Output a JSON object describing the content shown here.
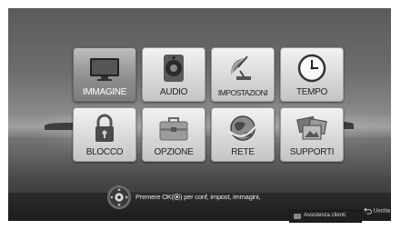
{
  "menu": {
    "items": [
      {
        "label": "IMMAGINE",
        "icon": "tv-icon",
        "selected": true
      },
      {
        "label": "AUDIO",
        "icon": "speaker-icon",
        "selected": false
      },
      {
        "label": "IMPOSTAZIONI",
        "icon": "satellite-dish-icon",
        "selected": false
      },
      {
        "label": "TEMPO",
        "icon": "clock-icon",
        "selected": false
      },
      {
        "label": "BLOCCO",
        "icon": "padlock-icon",
        "selected": false
      },
      {
        "label": "OPZIONE",
        "icon": "toolbox-icon",
        "selected": false
      },
      {
        "label": "RETE",
        "icon": "globe-network-icon",
        "selected": false
      },
      {
        "label": "SUPPORTI",
        "icon": "media-icon",
        "selected": false
      }
    ]
  },
  "footer": {
    "hint_prefix": "Premere OK(",
    "hint_suffix": ") per conf, impost, immagini,",
    "support_label": "Assistenza clienti",
    "exit_label": "Uscita"
  },
  "colors": {
    "tile_normal": "#d9d9d9",
    "tile_selected": "#8f8f8f",
    "bar": "#1c1c1c"
  }
}
